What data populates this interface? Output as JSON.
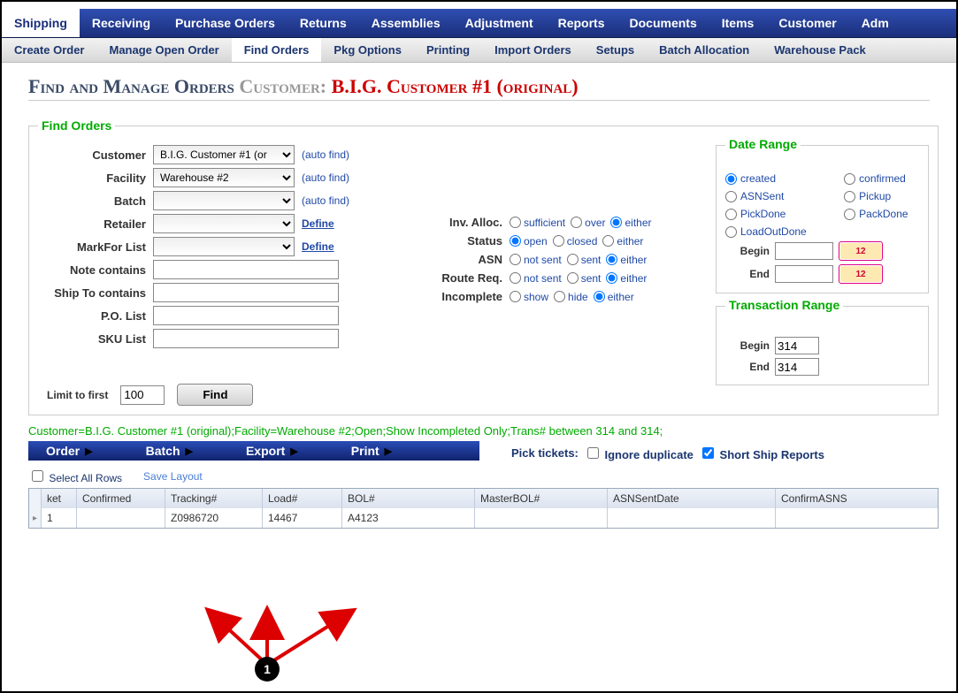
{
  "topnav": [
    "Shipping",
    "Receiving",
    "Purchase Orders",
    "Returns",
    "Assemblies",
    "Adjustment",
    "Reports",
    "Documents",
    "Items",
    "Customer",
    "Adm"
  ],
  "topnav_active": 0,
  "subnav": [
    "Create Order",
    "Manage Open Order",
    "Find Orders",
    "Pkg Options",
    "Printing",
    "Import Orders",
    "Setups",
    "Batch Allocation",
    "Warehouse Pack"
  ],
  "subnav_active": 2,
  "title": {
    "main": "Find and Manage Orders",
    "cust_label": "Customer:",
    "cust_name": "B.I.G. Customer #1 (original)"
  },
  "fieldset_legend": "Find Orders",
  "form": {
    "customer_label": "Customer",
    "customer_value": "B.I.G. Customer #1 (or",
    "customer_auto": "(auto find)",
    "facility_label": "Facility",
    "facility_value": "Warehouse #2",
    "facility_auto": "(auto find)",
    "batch_label": "Batch",
    "batch_value": "",
    "batch_auto": "(auto find)",
    "retailer_label": "Retailer",
    "retailer_value": "",
    "retailer_define": "Define",
    "markfor_label": "MarkFor List",
    "markfor_value": "",
    "markfor_define": "Define",
    "note_label": "Note contains",
    "note_value": "",
    "shipto_label": "Ship To contains",
    "shipto_value": "",
    "po_label": "P.O. List",
    "po_value": "",
    "sku_label": "SKU List",
    "sku_value": "",
    "limit_label": "Limit to first",
    "limit_value": "100",
    "find_btn": "Find"
  },
  "radios": {
    "inv": {
      "label": "Inv. Alloc.",
      "opts": [
        "sufficient",
        "over",
        "either"
      ],
      "sel": 2
    },
    "status": {
      "label": "Status",
      "opts": [
        "open",
        "closed",
        "either"
      ],
      "sel": 0
    },
    "asn": {
      "label": "ASN",
      "opts": [
        "not sent",
        "sent",
        "either"
      ],
      "sel": 2
    },
    "route": {
      "label": "Route Req.",
      "opts": [
        "not sent",
        "sent",
        "either"
      ],
      "sel": 2
    },
    "inc": {
      "label": "Incomplete",
      "opts": [
        "show",
        "hide",
        "either"
      ],
      "sel": 2
    }
  },
  "date_range": {
    "legend": "Date Range",
    "opts": [
      "created",
      "confirmed",
      "ASNSent",
      "Pickup",
      "PickDone",
      "PackDone",
      "LoadOutDone"
    ],
    "sel": 0,
    "begin_label": "Begin",
    "begin_value": "",
    "end_label": "End",
    "end_value": ""
  },
  "trans_range": {
    "legend": "Transaction Range",
    "begin_label": "Begin",
    "begin_value": "314",
    "end_label": "End",
    "end_value": "314"
  },
  "criteria": "Customer=B.I.G. Customer #1 (original);Facility=Warehouse #2;Open;Show Incompleted Only;Trans# between 314 and 314;",
  "actionbar": {
    "items": [
      "Order",
      "Batch",
      "Export",
      "Print"
    ],
    "pick_label": "Pick tickets:",
    "ignore": "Ignore duplicate",
    "short": "Short Ship Reports",
    "short_checked": true,
    "ignore_checked": false
  },
  "gridctrl": {
    "selectall": "Select All Rows",
    "save": "Save Layout"
  },
  "grid": {
    "headers": [
      "ket",
      "Confirmed",
      "Tracking#",
      "Load#",
      "BOL#",
      "MasterBOL#",
      "ASNSentDate",
      "ConfirmASNS"
    ],
    "rows": [
      {
        "ket": "1",
        "confirmed": "",
        "tracking": "Z0986720",
        "load": "14467",
        "bol": "A4123",
        "mbol": "",
        "asn": "",
        "cas": ""
      }
    ]
  },
  "annotation": "1"
}
